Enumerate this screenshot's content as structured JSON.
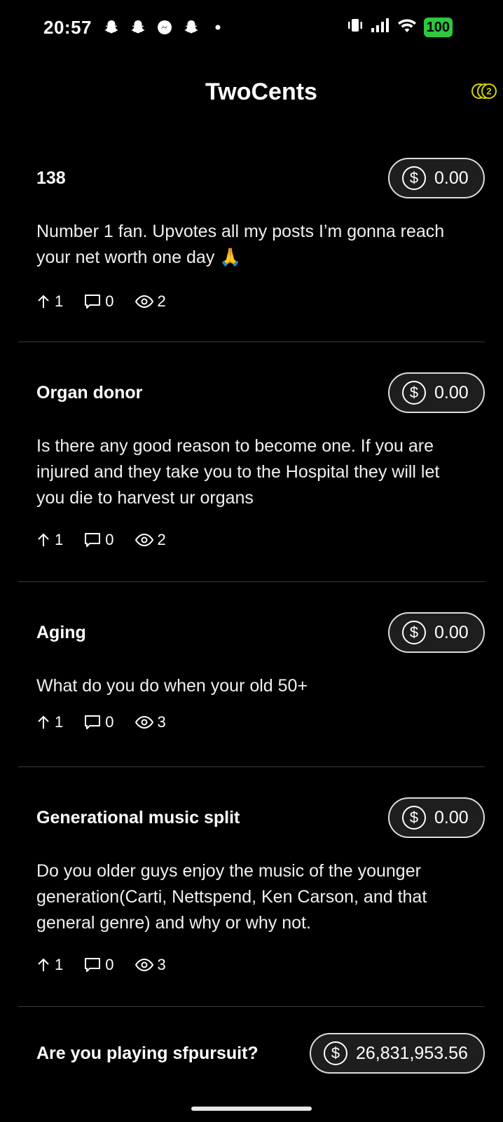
{
  "status_bar": {
    "time": "20:57",
    "battery": "100",
    "notification_icons": [
      "snapchat-icon",
      "snapchat-icon",
      "messenger-icon",
      "snapchat-icon",
      "dot-icon"
    ]
  },
  "header": {
    "title": "TwoCents",
    "coin_badge": "2"
  },
  "posts": [
    {
      "title": "138",
      "amount": "0.00",
      "body": "Number 1 fan. Upvotes all my posts I’m gonna reach your net worth one day 🙏",
      "upvotes": "1",
      "comments": "0",
      "views": "2"
    },
    {
      "title": "Organ donor",
      "amount": "0.00",
      "body": "Is there any good reason to become one. If you are injured and they take you to the Hospital they will let you die to harvest ur organs",
      "upvotes": "1",
      "comments": "0",
      "views": "2"
    },
    {
      "title": "Aging",
      "amount": "0.00",
      "body": "What do you do when your old 50+",
      "upvotes": "1",
      "comments": "0",
      "views": "3"
    },
    {
      "title": "Generational music split",
      "amount": "0.00",
      "body": "Do you older guys enjoy the music of the younger generation(Carti, Nettspend, Ken Carson, and that general genre) and why or why not.",
      "upvotes": "1",
      "comments": "0",
      "views": "3"
    },
    {
      "title": "Are you playing sfpursuit?",
      "amount": "26,831,953.56"
    }
  ],
  "colors": {
    "background": "#000000",
    "battery": "#2ec840",
    "coin_accent": "#d4d400",
    "divider": "#3a3a3a"
  }
}
